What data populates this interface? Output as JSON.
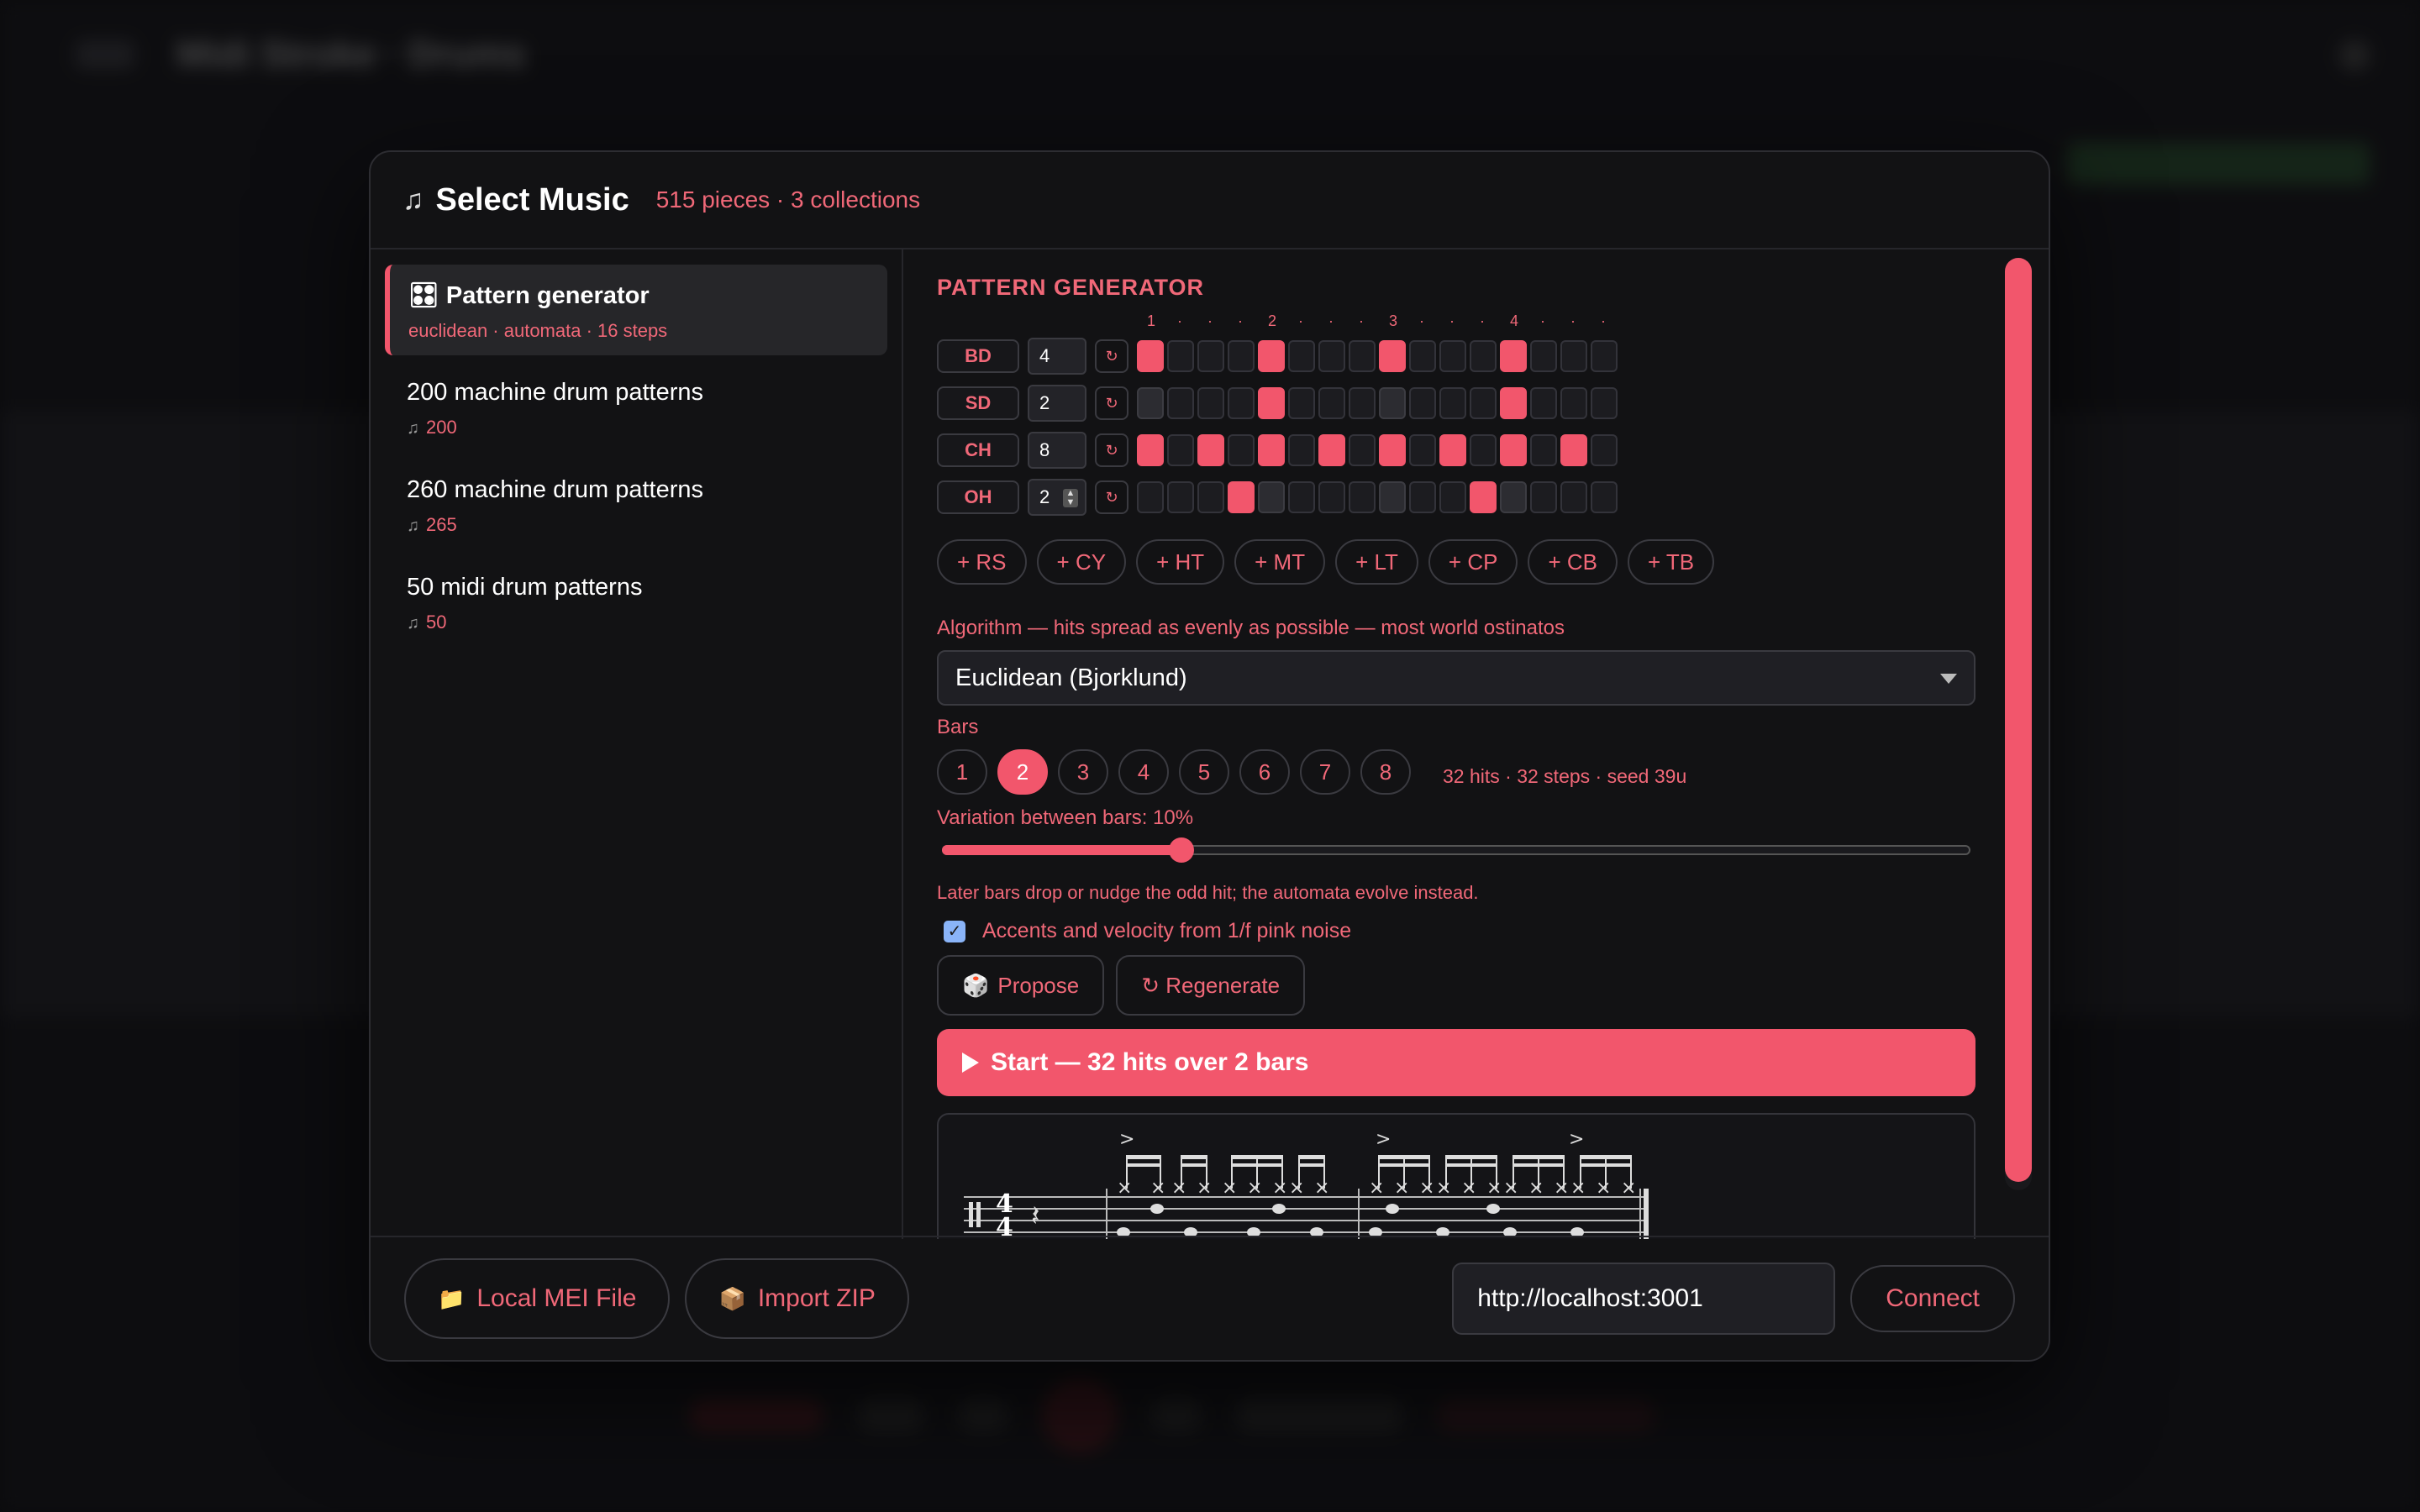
{
  "background": {
    "title": "Midi Stroke · Drums"
  },
  "modal": {
    "title": "Select Music",
    "subtitle": "515 pieces · 3 collections",
    "note_icon": "♫"
  },
  "collections": [
    {
      "icon": "🎛",
      "title": "Pattern generator",
      "subtitle": "euclidean · automata · 16 steps"
    },
    {
      "icon": "♫",
      "title": "200 machine drum patterns",
      "subtitle": "200"
    },
    {
      "icon": "♫",
      "title": "260 machine drum patterns",
      "subtitle": "265"
    },
    {
      "icon": "♫",
      "title": "50 midi drum patterns",
      "subtitle": "50"
    }
  ],
  "generator": {
    "section_title": "PATTERN GENERATOR",
    "ruler": [
      "1",
      "·",
      "·",
      "·",
      "2",
      "·",
      "·",
      "·",
      "3",
      "·",
      "·",
      "·",
      "4",
      "·",
      "·",
      "·"
    ],
    "lanes": [
      {
        "name": "BD",
        "hits": "4",
        "steps": [
          1,
          0,
          0,
          0,
          1,
          0,
          0,
          0,
          1,
          0,
          0,
          0,
          1,
          0,
          0,
          0
        ],
        "dim": []
      },
      {
        "name": "SD",
        "hits": "2",
        "steps": [
          0,
          0,
          0,
          0,
          1,
          0,
          0,
          0,
          0,
          0,
          0,
          0,
          1,
          0,
          0,
          0
        ],
        "dim": [
          0,
          8
        ]
      },
      {
        "name": "CH",
        "hits": "8",
        "steps": [
          1,
          0,
          1,
          0,
          1,
          0,
          1,
          0,
          1,
          0,
          1,
          0,
          1,
          0,
          1,
          0
        ],
        "dim": []
      },
      {
        "name": "OH",
        "hits": "2",
        "steps": [
          0,
          0,
          0,
          1,
          0,
          0,
          0,
          0,
          0,
          0,
          0,
          1,
          0,
          0,
          0,
          0
        ],
        "dim": [
          4,
          8,
          12
        ]
      }
    ],
    "regen_icon": "↻",
    "add_lanes": [
      "+ RS",
      "+ CY",
      "+ HT",
      "+ MT",
      "+ LT",
      "+ CP",
      "+ CB",
      "+ TB"
    ],
    "algorithm_label": "Algorithm — hits spread as evenly as possible — most world ostinatos",
    "algorithm_value": "Euclidean (Bjorklund)",
    "bars_label": "Bars",
    "bars": [
      "1",
      "2",
      "3",
      "4",
      "5",
      "6",
      "7",
      "8"
    ],
    "bars_selected": "2",
    "bars_info": "32 hits · 32 steps · seed 39u",
    "variation_label": "Variation between bars: 10%",
    "variation_value": 0.23,
    "variation_note": "Later bars drop or nudge the odd hit; the automata evolve instead.",
    "pink_noise_label": "Accents and velocity from 1/f pink noise",
    "pink_noise_checked": true,
    "propose_label": "Propose",
    "propose_icon": "🎲",
    "regenerate_label": "↻ Regenerate",
    "start_label": "Start — 32 hits over 2 bars",
    "time_signature": {
      "top": "4",
      "bottom": "4"
    }
  },
  "footer": {
    "local_mei_label": "Local MEI File",
    "local_mei_icon": "📁",
    "import_zip_label": "Import ZIP",
    "import_zip_icon": "📦",
    "server_url": "http://localhost:3001",
    "connect_label": "Connect"
  },
  "colors": {
    "accent": "#f2566c",
    "accent_text": "#f06878",
    "panel": "#121214"
  }
}
